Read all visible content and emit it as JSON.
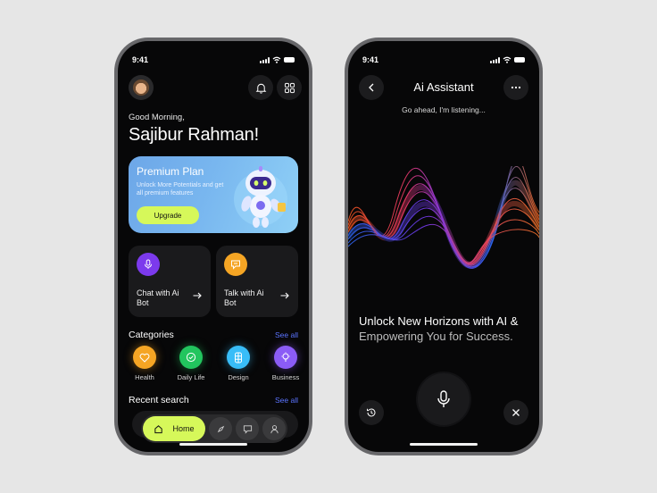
{
  "left_screen": {
    "status": {
      "time": "9:41"
    },
    "header": {
      "avatar_icon": "user-avatar",
      "icons": [
        "bell-icon",
        "grid-icon"
      ]
    },
    "greeting": "Good Morning,",
    "user_name": "Sajibur Rahman!",
    "plan_card": {
      "title": "Premium Plan",
      "description": "Unlock More Potentials and get all premium features",
      "button": "Upgrade",
      "image_icon": "robot-mascot"
    },
    "action_cards": [
      {
        "label": "Chat with Ai Bot",
        "icon": "mic-icon",
        "color": "#7c3aed"
      },
      {
        "label": "Talk with Ai Bot",
        "icon": "chat-icon",
        "color": "#f5a524"
      }
    ],
    "categories": {
      "title": "Categories",
      "see_all": "See all",
      "items": [
        {
          "label": "Health",
          "icon": "heart-icon",
          "color": "#f5a524"
        },
        {
          "label": "Daily Life",
          "icon": "check-circle-icon",
          "color": "#22c55e"
        },
        {
          "label": "Design",
          "icon": "figma-icon",
          "color": "#38bdf8"
        },
        {
          "label": "Business",
          "icon": "bulb-icon",
          "color": "#8b5cf6"
        }
      ]
    },
    "recent_search": {
      "title": "Recent search",
      "see_all": "See all"
    },
    "tab_bar": {
      "active_label": "Home",
      "icons": [
        "home-icon",
        "compass-icon",
        "message-icon",
        "profile-icon"
      ]
    }
  },
  "right_screen": {
    "status": {
      "time": "9:41"
    },
    "title": "Ai Assistant",
    "subtitle": "Go ahead, I'm listening...",
    "headline_bright": "Unlock New Horizons with AI & ",
    "headline_dim": "Empowering You for Success.",
    "controls": [
      "history-icon",
      "mic-icon",
      "close-icon"
    ]
  },
  "colors": {
    "accent_lime": "#d6f85a",
    "link_blue": "#5b74ff",
    "background": "#e6e6e6",
    "screen": "#070708"
  }
}
